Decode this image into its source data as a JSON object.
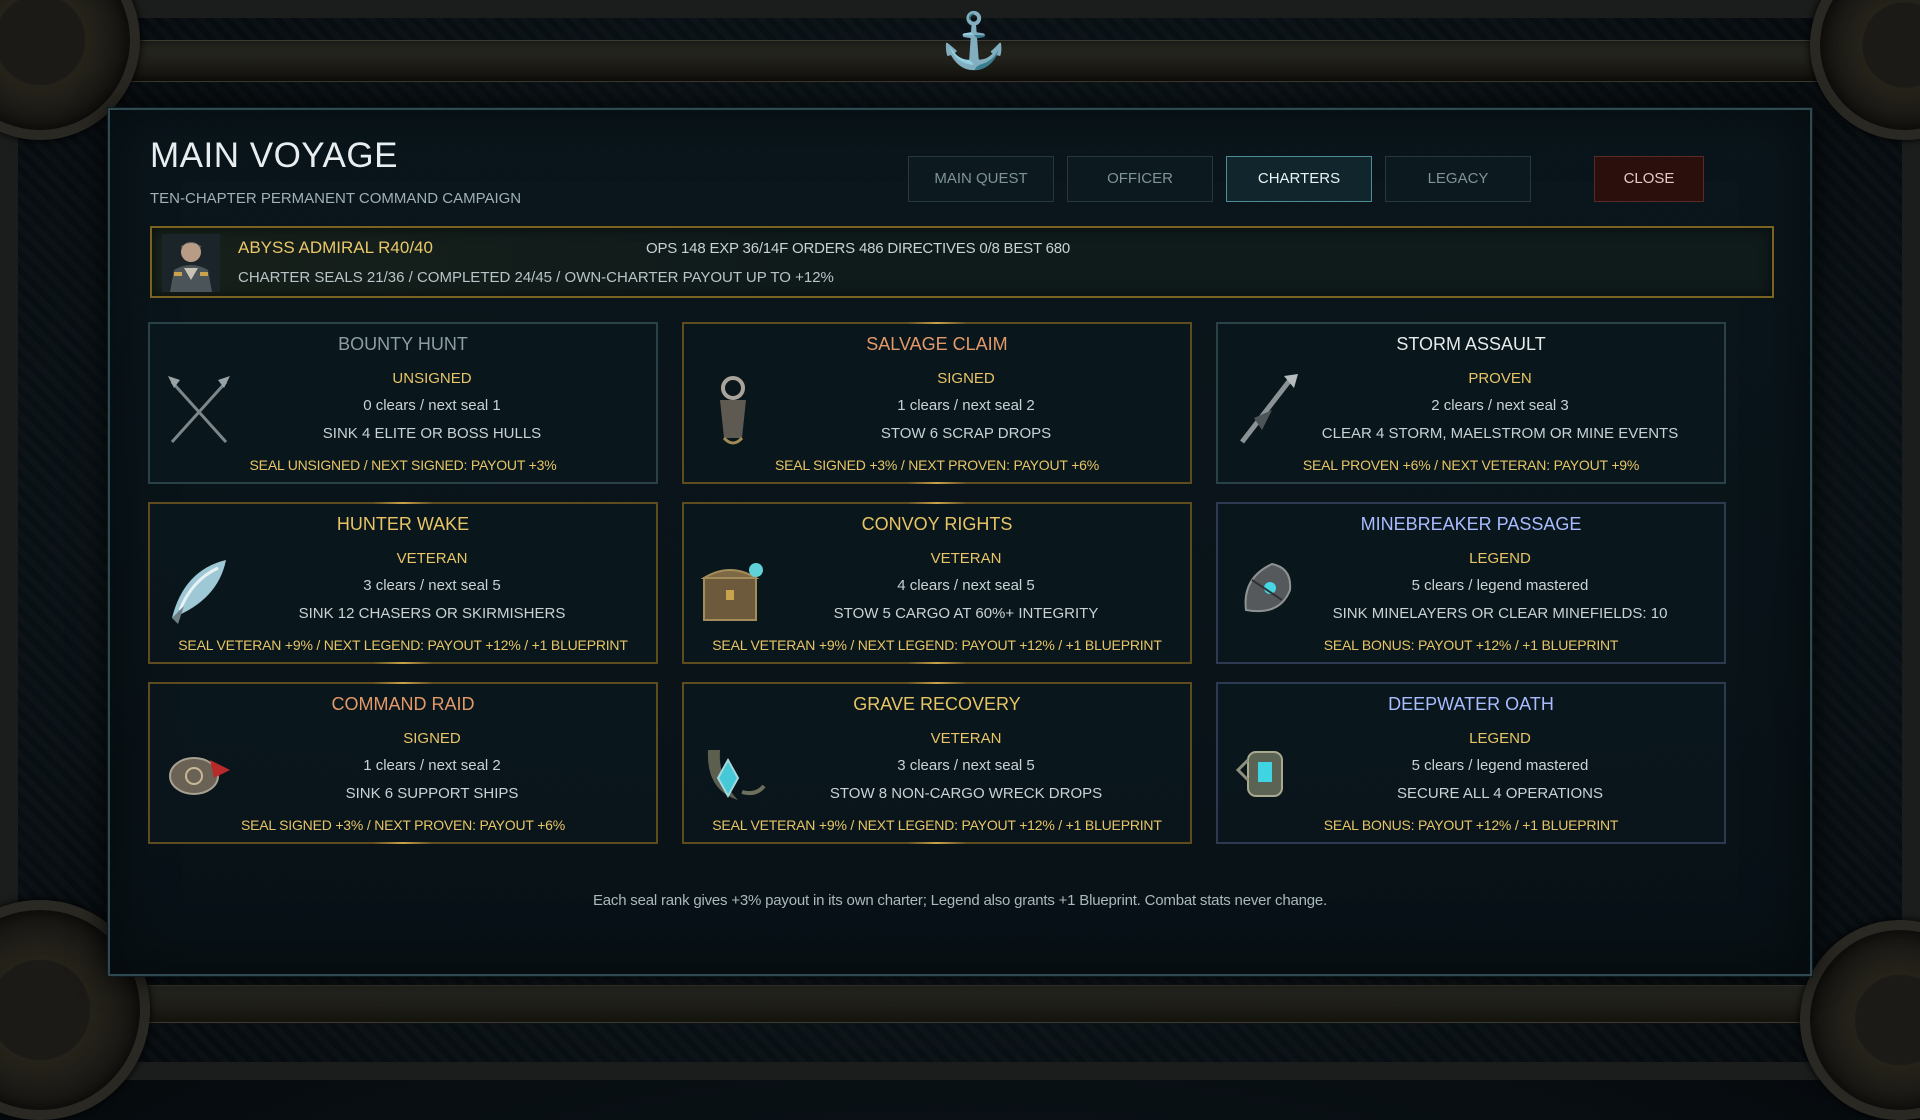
{
  "window": {
    "title": "MAIN VOYAGE",
    "subtitle": "TEN-CHAPTER PERMANENT COMMAND CAMPAIGN"
  },
  "tabs": [
    {
      "label": "MAIN QUEST",
      "active": false
    },
    {
      "label": "OFFICER",
      "active": false
    },
    {
      "label": "CHARTERS",
      "active": true
    },
    {
      "label": "LEGACY",
      "active": false
    }
  ],
  "close_label": "CLOSE",
  "admiral": {
    "name": "ABYSS ADMIRAL  R40/40",
    "stats": "OPS 148   EXP 36/14F   ORDERS 486   DIRECTIVES 0/8   BEST 680",
    "progress": "CHARTER SEALS 21/36  /  COMPLETED 24/45  /  OWN-CHARTER PAYOUT UP TO +12%",
    "avatar_icon": "admiral-portrait-icon"
  },
  "colors": {
    "gold": "#e7c566",
    "rank_orange": "#e39a6a",
    "legend_blue": "#a9bcff",
    "accent_teal": "#4d8d94",
    "close_red": "#2a0f0c"
  },
  "cards": [
    {
      "title": "BOUNTY HUNT",
      "title_color": "#8d9ea2",
      "rank": "UNSIGNED",
      "clears": "0 clears  /  next seal 1",
      "goal": "SINK 4 ELITE OR BOSS HULLS",
      "seal": "SEAL UNSIGNED / NEXT SIGNED: PAYOUT +3%",
      "icon": "crossed-harpoons-icon",
      "border": "steel"
    },
    {
      "title": "SALVAGE CLAIM",
      "title_color": "#e39a6a",
      "rank": "SIGNED",
      "clears": "1 clears  /  next seal 2",
      "goal": "STOW 6 SCRAP DROPS",
      "seal": "SEAL SIGNED +3% / NEXT PROVEN: PAYOUT +6%",
      "icon": "salvage-hook-icon",
      "border": "gold"
    },
    {
      "title": "STORM ASSAULT",
      "title_color": "#e6eaea",
      "rank": "PROVEN",
      "clears": "2 clears  /  next seal 3",
      "goal": "CLEAR 4 STORM, MAELSTROM OR MINE EVENTS",
      "seal": "SEAL PROVEN +6% / NEXT VETERAN: PAYOUT +9%",
      "icon": "storm-spear-icon",
      "border": "steel"
    },
    {
      "title": "HUNTER WAKE",
      "title_color": "#e7c566",
      "rank": "VETERAN",
      "clears": "3 clears  /  next seal 5",
      "goal": "SINK 12 CHASERS OR SKIRMISHERS",
      "seal": "SEAL VETERAN +9% / NEXT LEGEND: PAYOUT +12% / +1 BLUEPRINT",
      "icon": "frost-wake-icon",
      "border": "gold"
    },
    {
      "title": "CONVOY RIGHTS",
      "title_color": "#e7c566",
      "rank": "VETERAN",
      "clears": "4 clears  /  next seal 5",
      "goal": "STOW 5 CARGO AT 60%+ INTEGRITY",
      "seal": "SEAL VETERAN +9% / NEXT LEGEND: PAYOUT +12% / +1 BLUEPRINT",
      "icon": "cargo-chest-icon",
      "border": "gold"
    },
    {
      "title": "MINEBREAKER PASSAGE",
      "title_color": "#a9bcff",
      "rank": "LEGEND",
      "clears": "5 clears  /  legend mastered",
      "goal": "SINK MINELAYERS OR CLEAR MINEFIELDS: 10",
      "seal": "SEAL BONUS: PAYOUT +12% / +1 BLUEPRINT",
      "icon": "minebreaker-icon",
      "border": "violet"
    },
    {
      "title": "COMMAND RAID",
      "title_color": "#e39a6a",
      "rank": "SIGNED",
      "clears": "1 clears  /  next seal 2",
      "goal": "SINK 6 SUPPORT SHIPS",
      "seal": "SEAL SIGNED +3% / NEXT PROVEN: PAYOUT +6%",
      "icon": "raid-helm-icon",
      "border": "gold"
    },
    {
      "title": "GRAVE RECOVERY",
      "title_color": "#e7c566",
      "rank": "VETERAN",
      "clears": "3 clears  /  next seal 5",
      "goal": "STOW 8 NON-CARGO WRECK DROPS",
      "seal": "SEAL VETERAN +9% / NEXT LEGEND: PAYOUT +12% / +1 BLUEPRINT",
      "icon": "grave-anchor-icon",
      "border": "gold"
    },
    {
      "title": "DEEPWATER OATH",
      "title_color": "#a9bcff",
      "rank": "LEGEND",
      "clears": "5 clears  /  legend mastered",
      "goal": "SECURE ALL 4 OPERATIONS",
      "seal": "SEAL BONUS: PAYOUT +12% / +1 BLUEPRINT",
      "icon": "deepwater-gauntlet-icon",
      "border": "violet"
    }
  ],
  "footer": "Each seal rank gives +3% payout in its own charter; Legend also grants +1 Blueprint. Combat stats never change."
}
